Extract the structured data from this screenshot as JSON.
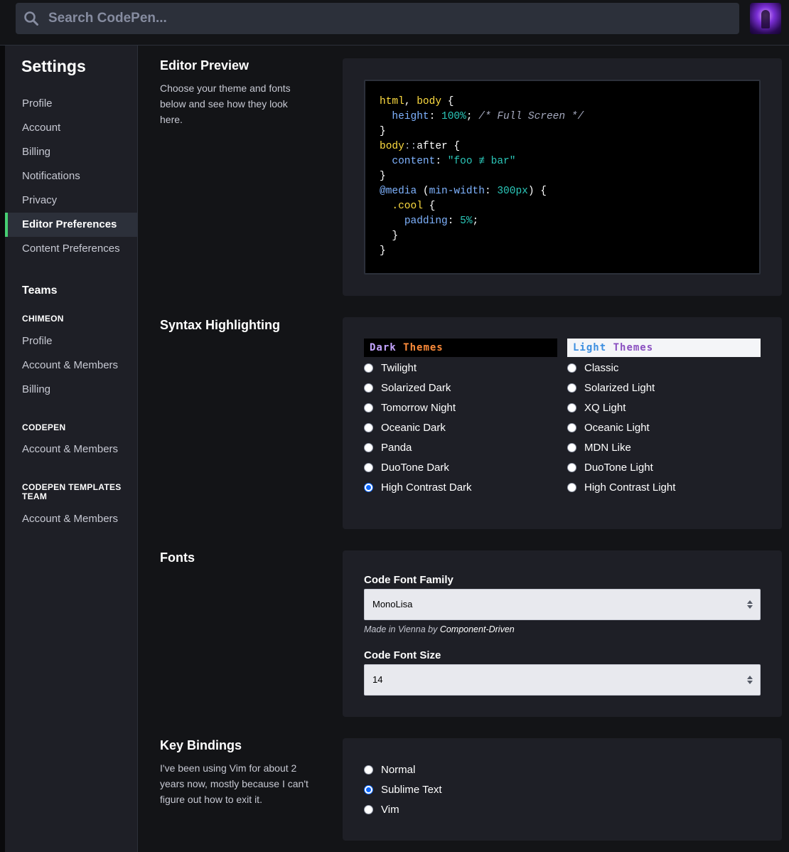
{
  "search": {
    "placeholder": "Search CodePen..."
  },
  "sidebar": {
    "title": "Settings",
    "items": [
      "Profile",
      "Account",
      "Billing",
      "Notifications",
      "Privacy",
      "Editor Preferences",
      "Content Preferences"
    ],
    "active_item": "Editor Preferences",
    "teams_heading": "Teams",
    "groups": [
      {
        "name": "CHIMEON",
        "items": [
          "Profile",
          "Account & Members",
          "Billing"
        ]
      },
      {
        "name": "CODEPEN",
        "items": [
          "Account & Members"
        ]
      },
      {
        "name": "CODEPEN TEMPLATES TEAM",
        "items": [
          "Account & Members"
        ]
      }
    ]
  },
  "editor_preview": {
    "title": "Editor Preview",
    "description": "Choose your theme and fonts below and see how they look here.",
    "code_lines": [
      "html, body {",
      "  height: 100%; /* Full Screen */",
      "}",
      "body::after {",
      "  content: \"foo ≢ bar\"",
      "}",
      "@media (min-width: 300px) {",
      "  .cool {",
      "    padding: 5%;",
      "  }",
      "}"
    ]
  },
  "syntax": {
    "title": "Syntax Highlighting",
    "dark_head_a": "Dark",
    "dark_head_b": "Themes",
    "light_head_a": "Light",
    "light_head_b": "Themes",
    "dark_themes": [
      "Twilight",
      "Solarized Dark",
      "Tomorrow Night",
      "Oceanic Dark",
      "Panda",
      "DuoTone Dark",
      "High Contrast Dark"
    ],
    "light_themes": [
      "Classic",
      "Solarized Light",
      "XQ Light",
      "Oceanic Light",
      "MDN Like",
      "DuoTone Light",
      "High Contrast Light"
    ],
    "selected": "High Contrast Dark",
    "colors": {
      "dark_a": "#c4a4ff",
      "dark_b": "#ff8c3a",
      "light_a": "#3b8ee0",
      "light_b": "#8a4fc0"
    }
  },
  "fonts": {
    "title": "Fonts",
    "family_label": "Code Font Family",
    "family_value": "MonoLisa",
    "note_prefix": "Made in Vienna by",
    "note_author": "Component-Driven",
    "size_label": "Code Font Size",
    "size_value": "14"
  },
  "keybindings": {
    "title": "Key Bindings",
    "description": "I've been using Vim for about 2 years now, mostly because I can't figure out how to exit it.",
    "options": [
      "Normal",
      "Sublime Text",
      "Vim"
    ],
    "selected": "Sublime Text"
  },
  "colors": {
    "accent": "#47cf73",
    "background": "#131417",
    "panel": "#1e1f26",
    "radio_checked": "#0a66ff"
  }
}
